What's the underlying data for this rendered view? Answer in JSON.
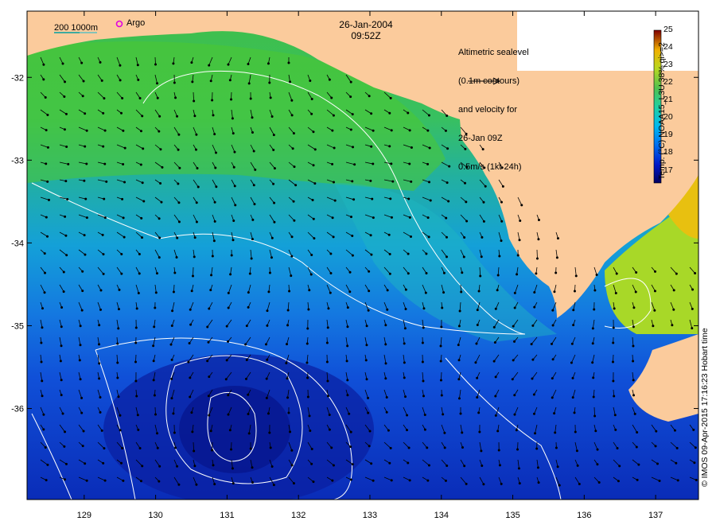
{
  "map": {
    "date": "26-Jan-2004",
    "time": "09:52Z",
    "legend_lines": [
      "Altimetric sealevel",
      "(0.1m contours)",
      "and velocity for",
      "26-Jan 09Z",
      "0.5m/s (1kt 24h)"
    ],
    "scale_label": "200  1000m",
    "argo_label": "Argo",
    "colorbar_title": "Temp. (°C) NOAA15_L3U 38% qi>=2",
    "credit": "© IMOS 09-Apr-2015 17:16:23 Hobart time",
    "colors": {
      "land": "#fbcb9c",
      "contour": "#ffffff",
      "argo": "#e000e0",
      "arrow": "#000000"
    }
  },
  "chart_data": {
    "type": "heatmap",
    "title": "26-Jan-2004 09:52Z",
    "xlabel": "",
    "ylabel": "",
    "x_ticks": [
      "129",
      "130",
      "131",
      "132",
      "133",
      "134",
      "135",
      "136",
      "137"
    ],
    "y_ticks": [
      "-32",
      "-33",
      "-34",
      "-35",
      "-36"
    ],
    "xlim": [
      128.2,
      137.6
    ],
    "ylim": [
      -37.1,
      -31.2
    ],
    "colorbar": {
      "label": "Temp. (°C) NOAA15_L3U 38% qi>=2",
      "ticks": [
        "25",
        "24",
        "23",
        "22",
        "21",
        "20",
        "19",
        "18",
        "17"
      ],
      "range": [
        16.3,
        25
      ]
    },
    "grid": true
  }
}
